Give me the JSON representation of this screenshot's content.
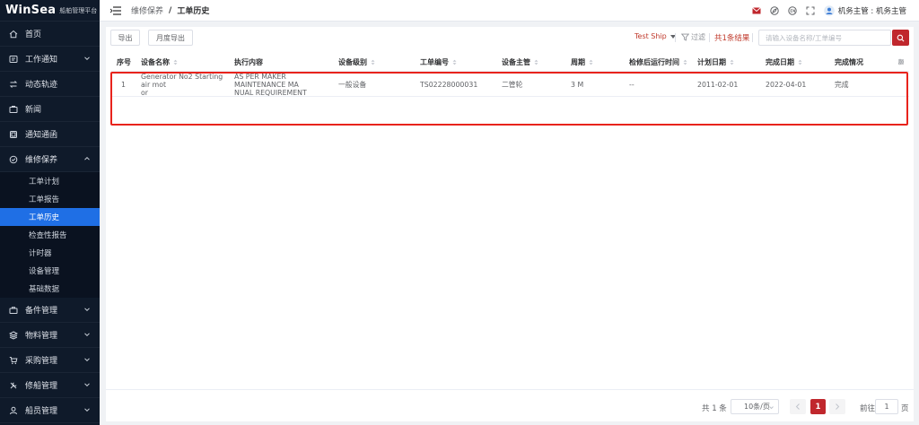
{
  "app": {
    "brand": "WinSea",
    "subtitle": "船舶管理平台"
  },
  "sidebar": {
    "items": [
      {
        "label": "首页",
        "icon": "home-icon"
      },
      {
        "label": "工作通知",
        "icon": "notice-icon",
        "expandable": true
      },
      {
        "label": "动态轨迹",
        "icon": "track-icon"
      },
      {
        "label": "新闻",
        "icon": "news-icon"
      },
      {
        "label": "通知通函",
        "icon": "circular-icon"
      },
      {
        "label": "维修保养",
        "icon": "maintenance-icon",
        "expanded": true
      }
    ],
    "submenu": [
      {
        "label": "工单计划"
      },
      {
        "label": "工单报告"
      },
      {
        "label": "工单历史",
        "active": true
      },
      {
        "label": "检查性报告"
      },
      {
        "label": "计时器"
      },
      {
        "label": "设备管理"
      },
      {
        "label": "基础数据"
      }
    ],
    "bottom_items": [
      {
        "label": "备件管理",
        "icon": "spare-parts-icon"
      },
      {
        "label": "物料管理",
        "icon": "materials-icon"
      },
      {
        "label": "采购管理",
        "icon": "cart-icon"
      },
      {
        "label": "修船管理",
        "icon": "repair-icon"
      },
      {
        "label": "船员管理",
        "icon": "crew-icon"
      }
    ]
  },
  "header": {
    "breadcrumb_parent": "维修保养",
    "breadcrumb_sep": "/",
    "breadcrumb_current": "工单历史",
    "user_label": "机务主管 : 机务主管"
  },
  "toolbar": {
    "export_label": "导出",
    "monthly_export_label": "月度导出",
    "ship_select": "Test Ship",
    "filter_label": "过滤",
    "result_label": "共1条结果",
    "search_placeholder": "请输入设备名称/工单编号"
  },
  "table": {
    "columns": [
      "序号",
      "设备名称",
      "执行内容",
      "设备级别",
      "工单编号",
      "设备主管",
      "周期",
      "检修后运行时间",
      "计划日期",
      "完成日期",
      "完成情况"
    ],
    "rows": [
      {
        "index": "1",
        "equipment_line1": "Generator No2 Starting air mot",
        "equipment_line2": "or",
        "content_line1": "AS PER MAKER MAINTENANCE MA",
        "content_line2": "NUAL REQUIREMENT",
        "level": "一般设备",
        "order_no": "TS02228000031",
        "supervisor": "二管轮",
        "cycle": "3 M",
        "runtime": "--",
        "plan_date": "2011-02-01",
        "finish_date": "2022-04-01",
        "status": "完成"
      }
    ]
  },
  "pagination": {
    "total": "共 1 条",
    "page_size": "10条/页",
    "current_page": "1",
    "goto_label": "前往",
    "goto_value": "1",
    "page_unit": "页"
  },
  "colors": {
    "accent": "#c0272d",
    "sidebar_bg": "#0f1a2a",
    "active_item": "#1f6fe5",
    "highlight_border": "#e8231c"
  }
}
